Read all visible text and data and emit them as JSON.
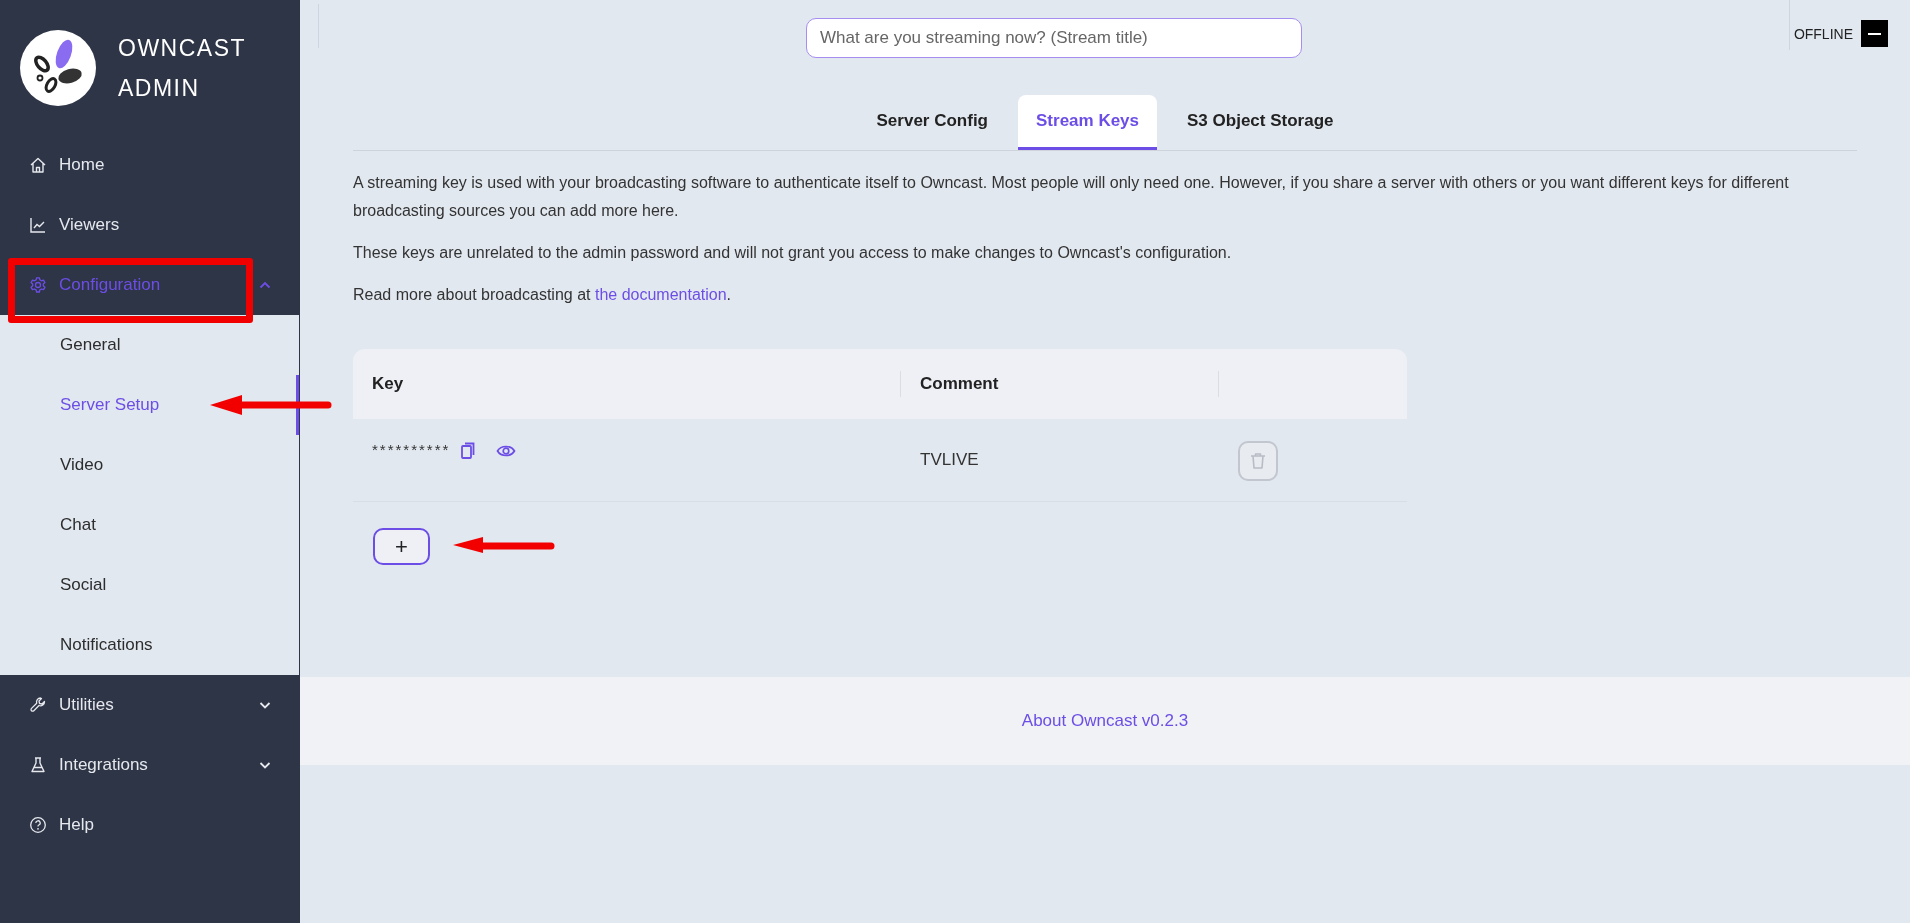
{
  "sidebar": {
    "title_lines": [
      "OWNCAST",
      "ADMIN"
    ],
    "items": [
      {
        "label": "Home",
        "selected": false
      },
      {
        "label": "Viewers",
        "selected": false
      },
      {
        "label": "Configuration",
        "selected": true,
        "expanded": true,
        "children": [
          {
            "label": "General",
            "selected": false
          },
          {
            "label": "Server Setup",
            "selected": true
          },
          {
            "label": "Video",
            "selected": false
          },
          {
            "label": "Chat",
            "selected": false
          },
          {
            "label": "Social",
            "selected": false
          },
          {
            "label": "Notifications",
            "selected": false
          }
        ]
      },
      {
        "label": "Utilities",
        "selected": false,
        "expanded": false
      },
      {
        "label": "Integrations",
        "selected": false,
        "expanded": false
      },
      {
        "label": "Help",
        "selected": false
      }
    ]
  },
  "header": {
    "stream_title": {
      "placeholder": "What are you streaming now? (Stream title)"
    },
    "status": "OFFLINE"
  },
  "tabs": [
    {
      "label": "Server Config",
      "selected": false
    },
    {
      "label": "Stream Keys",
      "selected": true
    },
    {
      "label": "S3 Object Storage",
      "selected": false
    }
  ],
  "description": [
    "A streaming key is used with your broadcasting software to authenticate itself to Owncast. Most people will only need one. However, if you share a server with others or you want different keys for different broadcasting sources you can add more here.",
    "These keys are unrelated to the admin password and will not grant you access to make changes to Owncast's configuration."
  ],
  "docs_note": {
    "text": "Read more about broadcasting at ",
    "link": "the documentation",
    "after": "."
  },
  "table": {
    "columns": [
      "Key",
      "Comment"
    ],
    "rows": [
      {
        "key": "**********",
        "comment": "TVLIVE",
        "delete_disabled": true
      }
    ]
  },
  "add_button": {
    "label": "+"
  },
  "footer": {
    "link": "About Owncast v0.2.3"
  }
}
